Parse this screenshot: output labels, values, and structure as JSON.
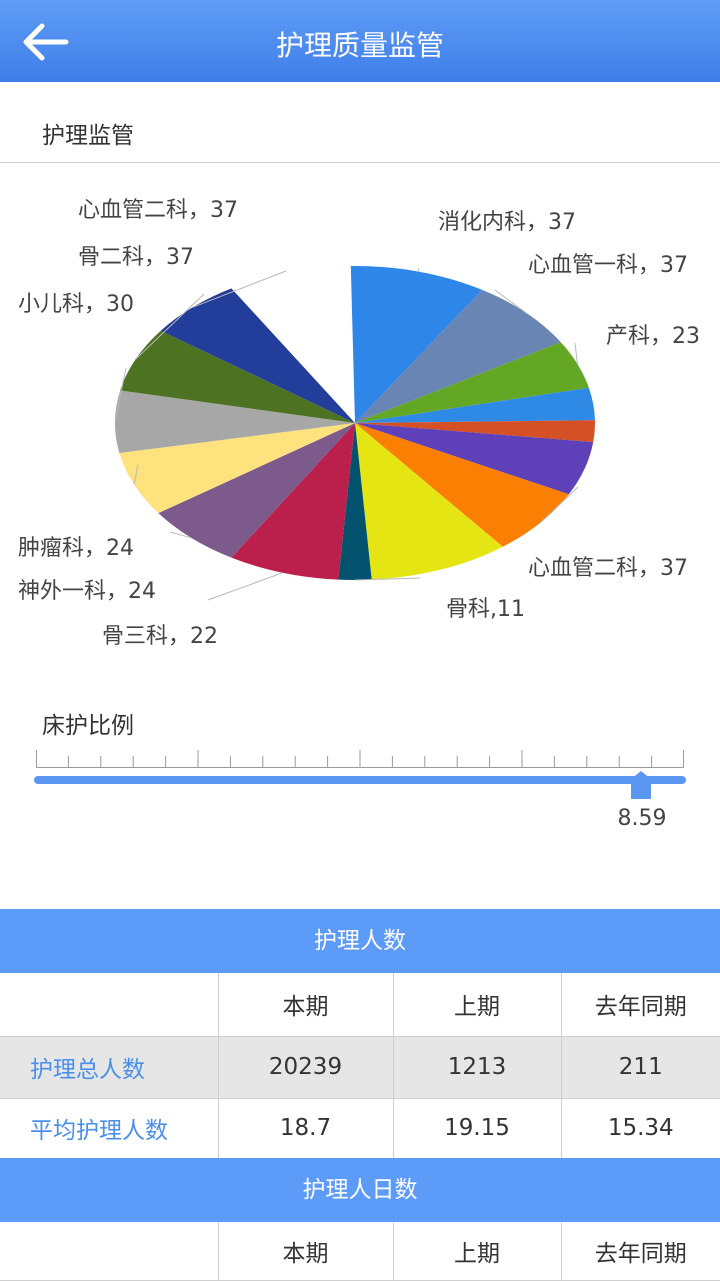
{
  "header": {
    "title": "护理质量监管"
  },
  "sections": {
    "pie_title": "护理监管",
    "slider_title": "床护比例"
  },
  "slider": {
    "value_label": "8.59",
    "fraction": 0.93
  },
  "chart_data": {
    "type": "pie",
    "slices": [
      {
        "label": "消化内科，37",
        "color": "#2e86e8"
      },
      {
        "label": "心血管一科，37",
        "color": "#6885b3"
      },
      {
        "label": "产科，23",
        "color": "#63a724"
      },
      {
        "label": "",
        "color": "#2f8ae6"
      },
      {
        "label": "",
        "color": "#d65026"
      },
      {
        "label": "",
        "color": "#5e41b8"
      },
      {
        "label": "心血管二科，37",
        "color": "#fb7f02"
      },
      {
        "label": "",
        "color": "#e6e514"
      },
      {
        "label": "骨科,11",
        "color": "#03536f"
      },
      {
        "label": "骨三科，22",
        "color": "#bb1f4c"
      },
      {
        "label": "神外一科，24",
        "color": "#7d5a8c"
      },
      {
        "label": "肿瘤科，24",
        "color": "#fde27e"
      },
      {
        "label": "小儿科，30",
        "color": "#a7a7a7"
      },
      {
        "label": "骨二科，37",
        "color": "#4c7222"
      },
      {
        "label": "心血管二科，37",
        "color": "#223d9a"
      }
    ]
  },
  "table1": {
    "title": "护理人数",
    "columns": [
      "",
      "本期",
      "上期",
      "去年同期"
    ],
    "rows": [
      {
        "label": "护理总人数",
        "values": [
          "20239",
          "1213",
          "211"
        ]
      },
      {
        "label": "平均护理人数",
        "values": [
          "18.7",
          "19.15",
          "15.34"
        ]
      }
    ]
  },
  "table2": {
    "title": "护理人日数",
    "columns": [
      "",
      "本期",
      "上期",
      "去年同期"
    ]
  }
}
